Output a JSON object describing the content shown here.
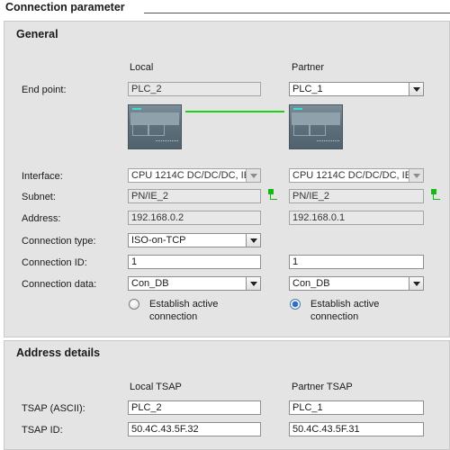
{
  "header": {
    "title": "Connection parameter"
  },
  "general": {
    "section_title": "General",
    "col_local": "Local",
    "col_partner": "Partner",
    "labels": {
      "end_point": "End point:",
      "interface": "Interface:",
      "subnet": "Subnet:",
      "address": "Address:",
      "connection_type": "Connection type:",
      "connection_id": "Connection ID:",
      "connection_data": "Connection data:"
    },
    "local": {
      "end_point": "PLC_2",
      "interface": "CPU 1214C DC/DC/DC, IE",
      "subnet": "PN/IE_2",
      "address": "192.168.0.2",
      "connection_type": "ISO-on-TCP",
      "connection_id": "1",
      "connection_data": "Con_DB",
      "establish_line1": "Establish active",
      "establish_line2": "connection",
      "establish_selected": false
    },
    "partner": {
      "end_point": "PLC_1",
      "interface": "CPU 1214C DC/DC/DC, IE",
      "subnet": "PN/IE_2",
      "address": "192.168.0.1",
      "connection_id": "1",
      "connection_data": "Con_DB",
      "establish_line1": "Establish active",
      "establish_line2": "connection",
      "establish_selected": true
    }
  },
  "address_details": {
    "section_title": "Address details",
    "col_local": "Local TSAP",
    "col_partner": "Partner TSAP",
    "labels": {
      "tsap_ascii": "TSAP (ASCII):",
      "tsap_id": "TSAP ID:"
    },
    "local": {
      "tsap_ascii": "PLC_2",
      "tsap_id": "50.4C.43.5F.32"
    },
    "partner": {
      "tsap_ascii": "PLC_1",
      "tsap_id": "50.4C.43.5F.31"
    }
  },
  "icons": {
    "plc_image": "plc-device-icon",
    "subnet": "network-connector-icon",
    "dropdown": "chevron-down-icon"
  },
  "colors": {
    "panel_bg": "#e4e4e4",
    "connection_line": "#1ed00f",
    "network_icon": "#14b814",
    "radio_selected": "#2e6fc2"
  }
}
